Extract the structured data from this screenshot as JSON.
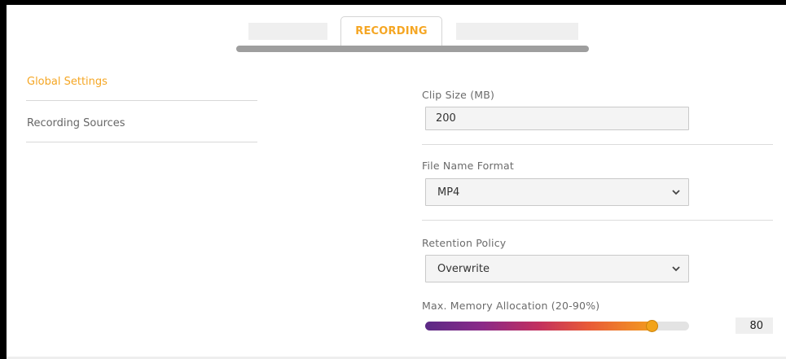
{
  "tabs": [
    {
      "label": ""
    },
    {
      "label": "RECORDING",
      "active": true
    },
    {
      "label": ""
    }
  ],
  "sidebar": {
    "items": [
      {
        "label": "Global Settings",
        "active": true
      },
      {
        "label": "Recording Sources",
        "active": false
      }
    ]
  },
  "form": {
    "clip_size": {
      "label": "Clip Size (MB)",
      "value": "200"
    },
    "file_name_format": {
      "label": "File Name Format",
      "selected": "MP4"
    },
    "retention_policy": {
      "label": "Retention Policy",
      "selected": "Overwrite"
    },
    "memory": {
      "label": "Max. Memory Allocation (20-90%)",
      "value": "80",
      "min": 20,
      "max": 90,
      "level": 80
    }
  },
  "colors": {
    "accent": "#f5a623",
    "gradient": [
      "#5b2a86",
      "#c2305f",
      "#f39a1f"
    ]
  },
  "icons": {
    "select_chevron": "chevron-down-icon"
  }
}
